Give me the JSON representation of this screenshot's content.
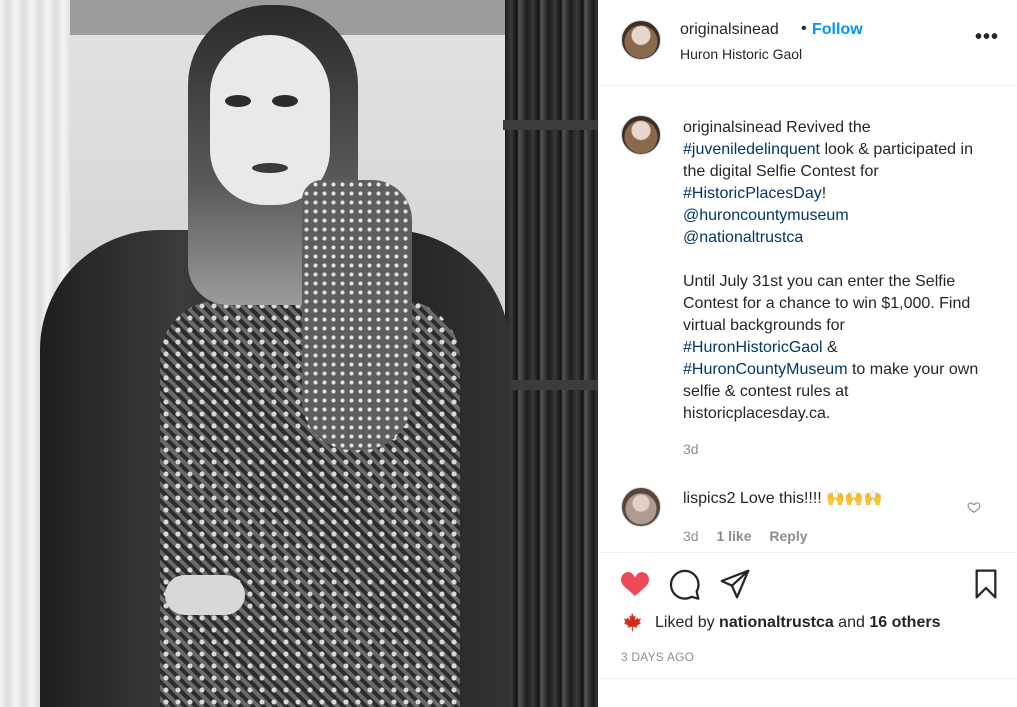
{
  "post": {
    "username": "originalsinead",
    "follow_label": "Follow",
    "dot": "•",
    "location": "Huron Historic Gaol",
    "more_icon": "more-options-icon",
    "more_glyph": "•••"
  },
  "caption": {
    "username": "originalsinead",
    "text_1": " Revived the ",
    "tag_1": "#juveniledelinquent",
    "text_2": " look & participated in the digital Selfie Contest for ",
    "tag_2": "#HistoricPlacesDay",
    "text_3": "!",
    "mention_1": "@huroncountymuseum",
    "mention_2": "@nationaltrustca",
    "para_2a": "Until July 31st you can enter the Selfie Contest for a chance to win $1,000. Find virtual backgrounds for ",
    "tag_3": "#HuronHistoricGaol",
    "para_2b": " & ",
    "tag_4": "#HuronCountyMuseum",
    "para_2c": " to make your own selfie & contest rules at historicplacesday.ca.",
    "time": "3d"
  },
  "comment": {
    "username": "lispics2",
    "text": " Love this!!!! ",
    "emoji": "🙌🙌🙌",
    "time": "3d",
    "likes": "1 like",
    "reply": "Reply"
  },
  "actions": {
    "like_icon": "heart-filled-icon",
    "comment_icon": "comment-icon",
    "share_icon": "share-icon",
    "save_icon": "bookmark-icon"
  },
  "likes": {
    "prefix": "Liked by ",
    "user": "nationaltrustca",
    "middle": " and ",
    "others": "16 others"
  },
  "date": "3 DAYS AGO",
  "colors": {
    "follow": "#0095f6",
    "link": "#00376b",
    "like_red": "#ed4956",
    "muted": "#8e8e8e",
    "leaf_red": "#d52b1e"
  }
}
